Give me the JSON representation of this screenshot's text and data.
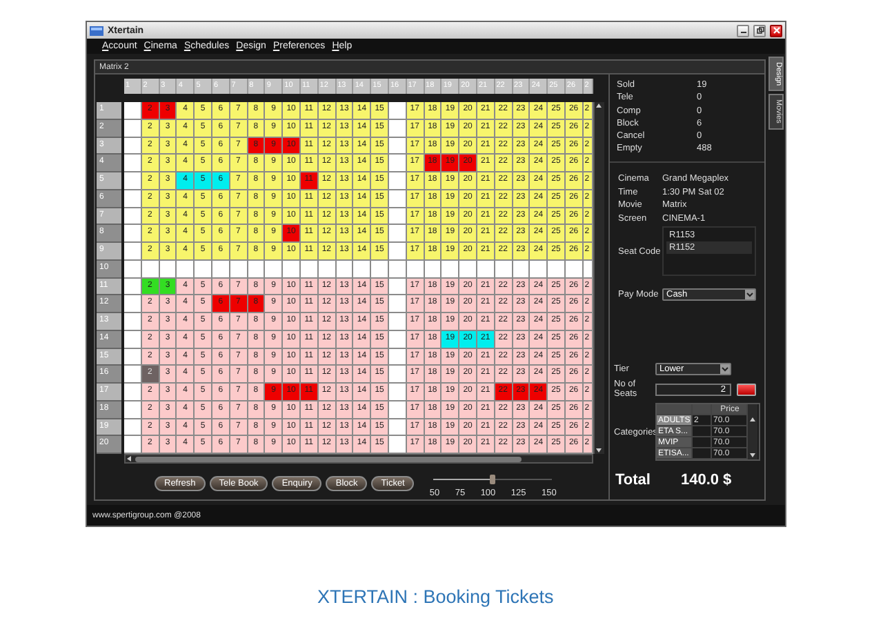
{
  "window": {
    "title": "Xtertain"
  },
  "menu": [
    "Account",
    "Cinema",
    "Schedules",
    "Design",
    "Preferences",
    "Help"
  ],
  "side_tabs": [
    {
      "label": "Design",
      "selected": true
    },
    {
      "label": "Movies",
      "selected": false
    }
  ],
  "frame_title": "Matrix 2",
  "columns": [
    "1",
    "2",
    "3",
    "4",
    "5",
    "6",
    "7",
    "8",
    "9",
    "10",
    "11",
    "12",
    "13",
    "14",
    "15",
    "16",
    "17",
    "18",
    "19",
    "20",
    "21",
    "22",
    "23",
    "24",
    "25",
    "26",
    "2"
  ],
  "rows": [
    {
      "label": "1",
      "kind": "seats",
      "color": "#f7f56c",
      "left_seats": [
        {
          "text": "2",
          "kind": "sold"
        },
        {
          "text": "3",
          "kind": "sold"
        },
        {
          "text": "4",
          "kind": "free"
        },
        {
          "text": "5",
          "kind": "free"
        },
        {
          "text": "6",
          "kind": "free"
        },
        {
          "text": "7",
          "kind": "free"
        },
        {
          "text": "8",
          "kind": "free"
        },
        {
          "text": "9",
          "kind": "free"
        },
        {
          "text": "10",
          "kind": "free"
        },
        {
          "text": "11",
          "kind": "free"
        },
        {
          "text": "12",
          "kind": "free"
        },
        {
          "text": "13",
          "kind": "free"
        },
        {
          "text": "14",
          "kind": "free"
        },
        {
          "text": "15",
          "kind": "free"
        }
      ],
      "right_seats": [
        {
          "text": "17",
          "kind": "free"
        },
        {
          "text": "18",
          "kind": "free"
        },
        {
          "text": "19",
          "kind": "free"
        },
        {
          "text": "20",
          "kind": "free"
        },
        {
          "text": "21",
          "kind": "free"
        },
        {
          "text": "22",
          "kind": "free"
        },
        {
          "text": "23",
          "kind": "free"
        },
        {
          "text": "24",
          "kind": "free"
        },
        {
          "text": "25",
          "kind": "free"
        },
        {
          "text": "26",
          "kind": "free"
        },
        {
          "text": "2",
          "kind": "free"
        }
      ]
    },
    {
      "label": "2",
      "kind": "seats",
      "color": "#f7f56c",
      "left_seats": [
        {
          "text": "2",
          "kind": "free"
        },
        {
          "text": "3",
          "kind": "free"
        },
        {
          "text": "4",
          "kind": "free"
        },
        {
          "text": "5",
          "kind": "free"
        },
        {
          "text": "6",
          "kind": "free"
        },
        {
          "text": "7",
          "kind": "free"
        },
        {
          "text": "8",
          "kind": "free"
        },
        {
          "text": "9",
          "kind": "free"
        },
        {
          "text": "10",
          "kind": "free"
        },
        {
          "text": "11",
          "kind": "free"
        },
        {
          "text": "12",
          "kind": "free"
        },
        {
          "text": "13",
          "kind": "free"
        },
        {
          "text": "14",
          "kind": "free"
        },
        {
          "text": "15",
          "kind": "free"
        }
      ],
      "right_seats": [
        {
          "text": "17",
          "kind": "free"
        },
        {
          "text": "18",
          "kind": "free"
        },
        {
          "text": "19",
          "kind": "free"
        },
        {
          "text": "20",
          "kind": "free"
        },
        {
          "text": "21",
          "kind": "free"
        },
        {
          "text": "22",
          "kind": "free"
        },
        {
          "text": "23",
          "kind": "free"
        },
        {
          "text": "24",
          "kind": "free"
        },
        {
          "text": "25",
          "kind": "free"
        },
        {
          "text": "26",
          "kind": "free"
        },
        {
          "text": "2",
          "kind": "free"
        }
      ]
    },
    {
      "label": "3",
      "kind": "seats",
      "color": "#f7f56c",
      "left_seats": [
        {
          "text": "2",
          "kind": "free"
        },
        {
          "text": "3",
          "kind": "free"
        },
        {
          "text": "4",
          "kind": "free"
        },
        {
          "text": "5",
          "kind": "free"
        },
        {
          "text": "6",
          "kind": "free"
        },
        {
          "text": "7",
          "kind": "free"
        },
        {
          "text": "8",
          "kind": "sold"
        },
        {
          "text": "9",
          "kind": "sold"
        },
        {
          "text": "10",
          "kind": "sold"
        },
        {
          "text": "11",
          "kind": "free"
        },
        {
          "text": "12",
          "kind": "free"
        },
        {
          "text": "13",
          "kind": "free"
        },
        {
          "text": "14",
          "kind": "free"
        },
        {
          "text": "15",
          "kind": "free"
        }
      ],
      "right_seats": [
        {
          "text": "17",
          "kind": "free"
        },
        {
          "text": "18",
          "kind": "free"
        },
        {
          "text": "19",
          "kind": "free"
        },
        {
          "text": "20",
          "kind": "free"
        },
        {
          "text": "21",
          "kind": "free"
        },
        {
          "text": "22",
          "kind": "free"
        },
        {
          "text": "23",
          "kind": "free"
        },
        {
          "text": "24",
          "kind": "free"
        },
        {
          "text": "25",
          "kind": "free"
        },
        {
          "text": "26",
          "kind": "free"
        },
        {
          "text": "2",
          "kind": "free"
        }
      ]
    },
    {
      "label": "4",
      "kind": "seats",
      "color": "#f7f56c",
      "left_seats": [
        {
          "text": "2",
          "kind": "free"
        },
        {
          "text": "3",
          "kind": "free"
        },
        {
          "text": "4",
          "kind": "free"
        },
        {
          "text": "5",
          "kind": "free"
        },
        {
          "text": "6",
          "kind": "free"
        },
        {
          "text": "7",
          "kind": "free"
        },
        {
          "text": "8",
          "kind": "free"
        },
        {
          "text": "9",
          "kind": "free"
        },
        {
          "text": "10",
          "kind": "free"
        },
        {
          "text": "11",
          "kind": "free"
        },
        {
          "text": "12",
          "kind": "free"
        },
        {
          "text": "13",
          "kind": "free"
        },
        {
          "text": "14",
          "kind": "free"
        },
        {
          "text": "15",
          "kind": "free"
        }
      ],
      "right_seats": [
        {
          "text": "17",
          "kind": "free"
        },
        {
          "text": "18",
          "kind": "sold"
        },
        {
          "text": "19",
          "kind": "sold"
        },
        {
          "text": "20",
          "kind": "sold"
        },
        {
          "text": "21",
          "kind": "free"
        },
        {
          "text": "22",
          "kind": "free"
        },
        {
          "text": "23",
          "kind": "free"
        },
        {
          "text": "24",
          "kind": "free"
        },
        {
          "text": "25",
          "kind": "free"
        },
        {
          "text": "26",
          "kind": "free"
        },
        {
          "text": "2",
          "kind": "free"
        }
      ]
    },
    {
      "label": "5",
      "kind": "seats",
      "color": "#f7f56c",
      "left_seats": [
        {
          "text": "2",
          "kind": "free"
        },
        {
          "text": "3",
          "kind": "free"
        },
        {
          "text": "4",
          "kind": "picked"
        },
        {
          "text": "5",
          "kind": "picked"
        },
        {
          "text": "6",
          "kind": "picked"
        },
        {
          "text": "7",
          "kind": "free"
        },
        {
          "text": "8",
          "kind": "free"
        },
        {
          "text": "9",
          "kind": "free"
        },
        {
          "text": "10",
          "kind": "free"
        },
        {
          "text": "11",
          "kind": "sold"
        },
        {
          "text": "12",
          "kind": "free"
        },
        {
          "text": "13",
          "kind": "free"
        },
        {
          "text": "14",
          "kind": "free"
        },
        {
          "text": "15",
          "kind": "free"
        }
      ],
      "right_seats": [
        {
          "text": "17",
          "kind": "free"
        },
        {
          "text": "18",
          "kind": "free"
        },
        {
          "text": "19",
          "kind": "free"
        },
        {
          "text": "20",
          "kind": "free"
        },
        {
          "text": "21",
          "kind": "free"
        },
        {
          "text": "22",
          "kind": "free"
        },
        {
          "text": "23",
          "kind": "free"
        },
        {
          "text": "24",
          "kind": "free"
        },
        {
          "text": "25",
          "kind": "free"
        },
        {
          "text": "26",
          "kind": "free"
        },
        {
          "text": "2",
          "kind": "free"
        }
      ]
    },
    {
      "label": "6",
      "kind": "seats",
      "color": "#f7f56c",
      "left_seats": [
        {
          "text": "2",
          "kind": "free"
        },
        {
          "text": "3",
          "kind": "free"
        },
        {
          "text": "4",
          "kind": "free"
        },
        {
          "text": "5",
          "kind": "free"
        },
        {
          "text": "6",
          "kind": "free"
        },
        {
          "text": "7",
          "kind": "free"
        },
        {
          "text": "8",
          "kind": "free"
        },
        {
          "text": "9",
          "kind": "free"
        },
        {
          "text": "10",
          "kind": "free"
        },
        {
          "text": "11",
          "kind": "free"
        },
        {
          "text": "12",
          "kind": "free"
        },
        {
          "text": "13",
          "kind": "free"
        },
        {
          "text": "14",
          "kind": "free"
        },
        {
          "text": "15",
          "kind": "free"
        }
      ],
      "right_seats": [
        {
          "text": "17",
          "kind": "free"
        },
        {
          "text": "18",
          "kind": "free"
        },
        {
          "text": "19",
          "kind": "free"
        },
        {
          "text": "20",
          "kind": "free"
        },
        {
          "text": "21",
          "kind": "free"
        },
        {
          "text": "22",
          "kind": "free"
        },
        {
          "text": "23",
          "kind": "free"
        },
        {
          "text": "24",
          "kind": "free"
        },
        {
          "text": "25",
          "kind": "free"
        },
        {
          "text": "26",
          "kind": "free"
        },
        {
          "text": "2",
          "kind": "free"
        }
      ]
    },
    {
      "label": "7",
      "kind": "seats",
      "color": "#f7f56c",
      "left_seats": [
        {
          "text": "2",
          "kind": "free"
        },
        {
          "text": "3",
          "kind": "free"
        },
        {
          "text": "4",
          "kind": "free"
        },
        {
          "text": "5",
          "kind": "free"
        },
        {
          "text": "6",
          "kind": "free"
        },
        {
          "text": "7",
          "kind": "free"
        },
        {
          "text": "8",
          "kind": "free"
        },
        {
          "text": "9",
          "kind": "free"
        },
        {
          "text": "10",
          "kind": "free"
        },
        {
          "text": "11",
          "kind": "free"
        },
        {
          "text": "12",
          "kind": "free"
        },
        {
          "text": "13",
          "kind": "free"
        },
        {
          "text": "14",
          "kind": "free"
        },
        {
          "text": "15",
          "kind": "free"
        }
      ],
      "right_seats": [
        {
          "text": "17",
          "kind": "free"
        },
        {
          "text": "18",
          "kind": "free"
        },
        {
          "text": "19",
          "kind": "free"
        },
        {
          "text": "20",
          "kind": "free"
        },
        {
          "text": "21",
          "kind": "free"
        },
        {
          "text": "22",
          "kind": "free"
        },
        {
          "text": "23",
          "kind": "free"
        },
        {
          "text": "24",
          "kind": "free"
        },
        {
          "text": "25",
          "kind": "free"
        },
        {
          "text": "26",
          "kind": "free"
        },
        {
          "text": "2",
          "kind": "free"
        }
      ]
    },
    {
      "label": "8",
      "kind": "seats",
      "color": "#f7f56c",
      "left_seats": [
        {
          "text": "2",
          "kind": "free"
        },
        {
          "text": "3",
          "kind": "free"
        },
        {
          "text": "4",
          "kind": "free"
        },
        {
          "text": "5",
          "kind": "free"
        },
        {
          "text": "6",
          "kind": "free"
        },
        {
          "text": "7",
          "kind": "free"
        },
        {
          "text": "8",
          "kind": "free"
        },
        {
          "text": "9",
          "kind": "free"
        },
        {
          "text": "10",
          "kind": "sold"
        },
        {
          "text": "11",
          "kind": "free"
        },
        {
          "text": "12",
          "kind": "free"
        },
        {
          "text": "13",
          "kind": "free"
        },
        {
          "text": "14",
          "kind": "free"
        },
        {
          "text": "15",
          "kind": "free"
        }
      ],
      "right_seats": [
        {
          "text": "17",
          "kind": "free"
        },
        {
          "text": "18",
          "kind": "free"
        },
        {
          "text": "19",
          "kind": "free"
        },
        {
          "text": "20",
          "kind": "free"
        },
        {
          "text": "21",
          "kind": "free"
        },
        {
          "text": "22",
          "kind": "free"
        },
        {
          "text": "23",
          "kind": "free"
        },
        {
          "text": "24",
          "kind": "free"
        },
        {
          "text": "25",
          "kind": "free"
        },
        {
          "text": "26",
          "kind": "free"
        },
        {
          "text": "2",
          "kind": "free"
        }
      ]
    },
    {
      "label": "9",
      "kind": "seats",
      "color": "#f7f56c",
      "left_seats": [
        {
          "text": "2",
          "kind": "free"
        },
        {
          "text": "3",
          "kind": "free"
        },
        {
          "text": "4",
          "kind": "free"
        },
        {
          "text": "5",
          "kind": "free"
        },
        {
          "text": "6",
          "kind": "free"
        },
        {
          "text": "7",
          "kind": "free"
        },
        {
          "text": "8",
          "kind": "free"
        },
        {
          "text": "9",
          "kind": "free"
        },
        {
          "text": "10",
          "kind": "free"
        },
        {
          "text": "11",
          "kind": "free"
        },
        {
          "text": "12",
          "kind": "free"
        },
        {
          "text": "13",
          "kind": "free"
        },
        {
          "text": "14",
          "kind": "free"
        },
        {
          "text": "15",
          "kind": "free"
        }
      ],
      "right_seats": [
        {
          "text": "17",
          "kind": "free"
        },
        {
          "text": "18",
          "kind": "free"
        },
        {
          "text": "19",
          "kind": "free"
        },
        {
          "text": "20",
          "kind": "free"
        },
        {
          "text": "21",
          "kind": "free"
        },
        {
          "text": "22",
          "kind": "free"
        },
        {
          "text": "23",
          "kind": "free"
        },
        {
          "text": "24",
          "kind": "free"
        },
        {
          "text": "25",
          "kind": "free"
        },
        {
          "text": "26",
          "kind": "free"
        },
        {
          "text": "2",
          "kind": "free"
        }
      ]
    },
    {
      "label": "10",
      "kind": "empty"
    },
    {
      "label": "11",
      "kind": "seats",
      "color": "#fccaca",
      "left_seats": [
        {
          "text": "2",
          "kind": "held"
        },
        {
          "text": "3",
          "kind": "held"
        },
        {
          "text": "4",
          "kind": "free"
        },
        {
          "text": "5",
          "kind": "free"
        },
        {
          "text": "6",
          "kind": "free"
        },
        {
          "text": "7",
          "kind": "free"
        },
        {
          "text": "8",
          "kind": "free"
        },
        {
          "text": "9",
          "kind": "free"
        },
        {
          "text": "10",
          "kind": "free"
        },
        {
          "text": "11",
          "kind": "free"
        },
        {
          "text": "12",
          "kind": "free"
        },
        {
          "text": "13",
          "kind": "free"
        },
        {
          "text": "14",
          "kind": "free"
        },
        {
          "text": "15",
          "kind": "free"
        }
      ],
      "right_seats": [
        {
          "text": "17",
          "kind": "free"
        },
        {
          "text": "18",
          "kind": "free"
        },
        {
          "text": "19",
          "kind": "free"
        },
        {
          "text": "20",
          "kind": "free"
        },
        {
          "text": "21",
          "kind": "free"
        },
        {
          "text": "22",
          "kind": "free"
        },
        {
          "text": "23",
          "kind": "free"
        },
        {
          "text": "24",
          "kind": "free"
        },
        {
          "text": "25",
          "kind": "free"
        },
        {
          "text": "26",
          "kind": "free"
        },
        {
          "text": "2",
          "kind": "free"
        }
      ]
    },
    {
      "label": "12",
      "kind": "seats",
      "color": "#fccaca",
      "left_seats": [
        {
          "text": "2",
          "kind": "free"
        },
        {
          "text": "3",
          "kind": "free"
        },
        {
          "text": "4",
          "kind": "free"
        },
        {
          "text": "5",
          "kind": "free"
        },
        {
          "text": "6",
          "kind": "sold"
        },
        {
          "text": "7",
          "kind": "sold"
        },
        {
          "text": "8",
          "kind": "sold"
        },
        {
          "text": "9",
          "kind": "free"
        },
        {
          "text": "10",
          "kind": "free"
        },
        {
          "text": "11",
          "kind": "free"
        },
        {
          "text": "12",
          "kind": "free"
        },
        {
          "text": "13",
          "kind": "free"
        },
        {
          "text": "14",
          "kind": "free"
        },
        {
          "text": "15",
          "kind": "free"
        }
      ],
      "right_seats": [
        {
          "text": "17",
          "kind": "free"
        },
        {
          "text": "18",
          "kind": "free"
        },
        {
          "text": "19",
          "kind": "free"
        },
        {
          "text": "20",
          "kind": "free"
        },
        {
          "text": "21",
          "kind": "free"
        },
        {
          "text": "22",
          "kind": "free"
        },
        {
          "text": "23",
          "kind": "free"
        },
        {
          "text": "24",
          "kind": "free"
        },
        {
          "text": "25",
          "kind": "free"
        },
        {
          "text": "26",
          "kind": "free"
        },
        {
          "text": "2",
          "kind": "free"
        }
      ]
    },
    {
      "label": "13",
      "kind": "seats",
      "color": "#fccaca",
      "left_seats": [
        {
          "text": "2",
          "kind": "free"
        },
        {
          "text": "3",
          "kind": "free"
        },
        {
          "text": "4",
          "kind": "free"
        },
        {
          "text": "5",
          "kind": "free"
        },
        {
          "text": "6",
          "kind": "free"
        },
        {
          "text": "7",
          "kind": "free"
        },
        {
          "text": "8",
          "kind": "free"
        },
        {
          "text": "9",
          "kind": "free"
        },
        {
          "text": "10",
          "kind": "free"
        },
        {
          "text": "11",
          "kind": "free"
        },
        {
          "text": "12",
          "kind": "free"
        },
        {
          "text": "13",
          "kind": "free"
        },
        {
          "text": "14",
          "kind": "free"
        },
        {
          "text": "15",
          "kind": "free"
        }
      ],
      "right_seats": [
        {
          "text": "17",
          "kind": "free"
        },
        {
          "text": "18",
          "kind": "free"
        },
        {
          "text": "19",
          "kind": "free"
        },
        {
          "text": "20",
          "kind": "free"
        },
        {
          "text": "21",
          "kind": "free"
        },
        {
          "text": "22",
          "kind": "free"
        },
        {
          "text": "23",
          "kind": "free"
        },
        {
          "text": "24",
          "kind": "free"
        },
        {
          "text": "25",
          "kind": "free"
        },
        {
          "text": "26",
          "kind": "free"
        },
        {
          "text": "2",
          "kind": "free"
        }
      ]
    },
    {
      "label": "14",
      "kind": "seats",
      "color": "#fccaca",
      "left_seats": [
        {
          "text": "2",
          "kind": "free"
        },
        {
          "text": "3",
          "kind": "free"
        },
        {
          "text": "4",
          "kind": "free"
        },
        {
          "text": "5",
          "kind": "free"
        },
        {
          "text": "6",
          "kind": "free"
        },
        {
          "text": "7",
          "kind": "free"
        },
        {
          "text": "8",
          "kind": "free"
        },
        {
          "text": "9",
          "kind": "free"
        },
        {
          "text": "10",
          "kind": "free"
        },
        {
          "text": "11",
          "kind": "free"
        },
        {
          "text": "12",
          "kind": "free"
        },
        {
          "text": "13",
          "kind": "free"
        },
        {
          "text": "14",
          "kind": "free"
        },
        {
          "text": "15",
          "kind": "free"
        }
      ],
      "right_seats": [
        {
          "text": "17",
          "kind": "free"
        },
        {
          "text": "18",
          "kind": "free"
        },
        {
          "text": "19",
          "kind": "picked"
        },
        {
          "text": "20",
          "kind": "picked"
        },
        {
          "text": "21",
          "kind": "picked"
        },
        {
          "text": "22",
          "kind": "free"
        },
        {
          "text": "23",
          "kind": "free"
        },
        {
          "text": "24",
          "kind": "free"
        },
        {
          "text": "25",
          "kind": "free"
        },
        {
          "text": "26",
          "kind": "free"
        },
        {
          "text": "2",
          "kind": "free"
        }
      ]
    },
    {
      "label": "15",
      "kind": "seats",
      "color": "#fccaca",
      "left_seats": [
        {
          "text": "2",
          "kind": "free"
        },
        {
          "text": "3",
          "kind": "free"
        },
        {
          "text": "4",
          "kind": "free"
        },
        {
          "text": "5",
          "kind": "free"
        },
        {
          "text": "6",
          "kind": "free"
        },
        {
          "text": "7",
          "kind": "free"
        },
        {
          "text": "8",
          "kind": "free"
        },
        {
          "text": "9",
          "kind": "free"
        },
        {
          "text": "10",
          "kind": "free"
        },
        {
          "text": "11",
          "kind": "free"
        },
        {
          "text": "12",
          "kind": "free"
        },
        {
          "text": "13",
          "kind": "free"
        },
        {
          "text": "14",
          "kind": "free"
        },
        {
          "text": "15",
          "kind": "free"
        }
      ],
      "right_seats": [
        {
          "text": "17",
          "kind": "free"
        },
        {
          "text": "18",
          "kind": "free"
        },
        {
          "text": "19",
          "kind": "free"
        },
        {
          "text": "20",
          "kind": "free"
        },
        {
          "text": "21",
          "kind": "free"
        },
        {
          "text": "22",
          "kind": "free"
        },
        {
          "text": "23",
          "kind": "free"
        },
        {
          "text": "24",
          "kind": "free"
        },
        {
          "text": "25",
          "kind": "free"
        },
        {
          "text": "26",
          "kind": "free"
        },
        {
          "text": "2",
          "kind": "free"
        }
      ]
    },
    {
      "label": "16",
      "kind": "seats",
      "color": "#fccaca",
      "left_seats": [
        {
          "text": "2",
          "kind": "blocked"
        },
        {
          "text": "3",
          "kind": "free"
        },
        {
          "text": "4",
          "kind": "free"
        },
        {
          "text": "5",
          "kind": "free"
        },
        {
          "text": "6",
          "kind": "free"
        },
        {
          "text": "7",
          "kind": "free"
        },
        {
          "text": "8",
          "kind": "free"
        },
        {
          "text": "9",
          "kind": "free"
        },
        {
          "text": "10",
          "kind": "free"
        },
        {
          "text": "11",
          "kind": "free"
        },
        {
          "text": "12",
          "kind": "free"
        },
        {
          "text": "13",
          "kind": "free"
        },
        {
          "text": "14",
          "kind": "free"
        },
        {
          "text": "15",
          "kind": "free"
        }
      ],
      "right_seats": [
        {
          "text": "17",
          "kind": "free"
        },
        {
          "text": "18",
          "kind": "free"
        },
        {
          "text": "19",
          "kind": "free"
        },
        {
          "text": "20",
          "kind": "free"
        },
        {
          "text": "21",
          "kind": "free"
        },
        {
          "text": "22",
          "kind": "free"
        },
        {
          "text": "23",
          "kind": "free"
        },
        {
          "text": "24",
          "kind": "free"
        },
        {
          "text": "25",
          "kind": "free"
        },
        {
          "text": "26",
          "kind": "free"
        },
        {
          "text": "2",
          "kind": "free"
        }
      ]
    },
    {
      "label": "17",
      "kind": "seats",
      "color": "#fccaca",
      "left_seats": [
        {
          "text": "2",
          "kind": "free"
        },
        {
          "text": "3",
          "kind": "free"
        },
        {
          "text": "4",
          "kind": "free"
        },
        {
          "text": "5",
          "kind": "free"
        },
        {
          "text": "6",
          "kind": "free"
        },
        {
          "text": "7",
          "kind": "free"
        },
        {
          "text": "8",
          "kind": "free"
        },
        {
          "text": "9",
          "kind": "sold"
        },
        {
          "text": "10",
          "kind": "sold"
        },
        {
          "text": "11",
          "kind": "sold"
        },
        {
          "text": "12",
          "kind": "free"
        },
        {
          "text": "13",
          "kind": "free"
        },
        {
          "text": "14",
          "kind": "free"
        },
        {
          "text": "15",
          "kind": "free"
        }
      ],
      "right_seats": [
        {
          "text": "17",
          "kind": "free"
        },
        {
          "text": "18",
          "kind": "free"
        },
        {
          "text": "19",
          "kind": "free"
        },
        {
          "text": "20",
          "kind": "free"
        },
        {
          "text": "21",
          "kind": "free"
        },
        {
          "text": "22",
          "kind": "sold"
        },
        {
          "text": "23",
          "kind": "sold"
        },
        {
          "text": "24",
          "kind": "sold"
        },
        {
          "text": "25",
          "kind": "free"
        },
        {
          "text": "26",
          "kind": "free"
        },
        {
          "text": "2",
          "kind": "free"
        }
      ]
    },
    {
      "label": "18",
      "kind": "seats",
      "color": "#fccaca",
      "left_seats": [
        {
          "text": "2",
          "kind": "free"
        },
        {
          "text": "3",
          "kind": "free"
        },
        {
          "text": "4",
          "kind": "free"
        },
        {
          "text": "5",
          "kind": "free"
        },
        {
          "text": "6",
          "kind": "free"
        },
        {
          "text": "7",
          "kind": "free"
        },
        {
          "text": "8",
          "kind": "free"
        },
        {
          "text": "9",
          "kind": "free"
        },
        {
          "text": "10",
          "kind": "free"
        },
        {
          "text": "11",
          "kind": "free"
        },
        {
          "text": "12",
          "kind": "free"
        },
        {
          "text": "13",
          "kind": "free"
        },
        {
          "text": "14",
          "kind": "free"
        },
        {
          "text": "15",
          "kind": "free"
        }
      ],
      "right_seats": [
        {
          "text": "17",
          "kind": "free"
        },
        {
          "text": "18",
          "kind": "free"
        },
        {
          "text": "19",
          "kind": "free"
        },
        {
          "text": "20",
          "kind": "free"
        },
        {
          "text": "21",
          "kind": "free"
        },
        {
          "text": "22",
          "kind": "free"
        },
        {
          "text": "23",
          "kind": "free"
        },
        {
          "text": "24",
          "kind": "free"
        },
        {
          "text": "25",
          "kind": "free"
        },
        {
          "text": "26",
          "kind": "free"
        },
        {
          "text": "2",
          "kind": "free"
        }
      ]
    },
    {
      "label": "19",
      "kind": "seats",
      "color": "#fccaca",
      "left_seats": [
        {
          "text": "2",
          "kind": "free"
        },
        {
          "text": "3",
          "kind": "free"
        },
        {
          "text": "4",
          "kind": "free"
        },
        {
          "text": "5",
          "kind": "free"
        },
        {
          "text": "6",
          "kind": "free"
        },
        {
          "text": "7",
          "kind": "free"
        },
        {
          "text": "8",
          "kind": "free"
        },
        {
          "text": "9",
          "kind": "free"
        },
        {
          "text": "10",
          "kind": "free"
        },
        {
          "text": "11",
          "kind": "free"
        },
        {
          "text": "12",
          "kind": "free"
        },
        {
          "text": "13",
          "kind": "free"
        },
        {
          "text": "14",
          "kind": "free"
        },
        {
          "text": "15",
          "kind": "free"
        }
      ],
      "right_seats": [
        {
          "text": "17",
          "kind": "free"
        },
        {
          "text": "18",
          "kind": "free"
        },
        {
          "text": "19",
          "kind": "free"
        },
        {
          "text": "20",
          "kind": "free"
        },
        {
          "text": "21",
          "kind": "free"
        },
        {
          "text": "22",
          "kind": "free"
        },
        {
          "text": "23",
          "kind": "free"
        },
        {
          "text": "24",
          "kind": "free"
        },
        {
          "text": "25",
          "kind": "free"
        },
        {
          "text": "26",
          "kind": "free"
        },
        {
          "text": "2",
          "kind": "free"
        }
      ]
    },
    {
      "label": "20",
      "kind": "seats",
      "color": "#fccaca",
      "left_seats": [
        {
          "text": "2",
          "kind": "free"
        },
        {
          "text": "3",
          "kind": "free"
        },
        {
          "text": "4",
          "kind": "free"
        },
        {
          "text": "5",
          "kind": "free"
        },
        {
          "text": "6",
          "kind": "free"
        },
        {
          "text": "7",
          "kind": "free"
        },
        {
          "text": "8",
          "kind": "free"
        },
        {
          "text": "9",
          "kind": "free"
        },
        {
          "text": "10",
          "kind": "free"
        },
        {
          "text": "11",
          "kind": "free"
        },
        {
          "text": "12",
          "kind": "free"
        },
        {
          "text": "13",
          "kind": "free"
        },
        {
          "text": "14",
          "kind": "free"
        },
        {
          "text": "15",
          "kind": "free"
        }
      ],
      "right_seats": [
        {
          "text": "17",
          "kind": "free"
        },
        {
          "text": "18",
          "kind": "free"
        },
        {
          "text": "19",
          "kind": "free"
        },
        {
          "text": "20",
          "kind": "free"
        },
        {
          "text": "21",
          "kind": "free"
        },
        {
          "text": "22",
          "kind": "free"
        },
        {
          "text": "23",
          "kind": "free"
        },
        {
          "text": "24",
          "kind": "free"
        },
        {
          "text": "25",
          "kind": "free"
        },
        {
          "text": "26",
          "kind": "free"
        },
        {
          "text": "2",
          "kind": "free"
        }
      ]
    }
  ],
  "actions": [
    "Refresh",
    "Tele Book",
    "Enquiry",
    "Block",
    "Ticket"
  ],
  "zoom_slider": {
    "level": 0.5,
    "ticks": [
      "50",
      "75",
      "100",
      "125",
      "150"
    ]
  },
  "stats": [
    {
      "label": "Sold",
      "value": "19"
    },
    {
      "label": "Tele",
      "value": "0"
    },
    {
      "label": "Comp",
      "value": "0"
    },
    {
      "label": "Block",
      "value": "6"
    },
    {
      "label": "Cancel",
      "value": "0"
    },
    {
      "label": "Empty",
      "value": "488"
    }
  ],
  "show_info": [
    {
      "label": "Cinema",
      "value": "Grand Megaplex"
    },
    {
      "label": "Time",
      "value": "1:30 PM  Sat 02"
    },
    {
      "label": "Movie",
      "value": "Matrix"
    },
    {
      "label": "Screen",
      "value": "CINEMA-1"
    }
  ],
  "seat_code": {
    "label": "Seat Code",
    "items": [
      {
        "text": "R1153",
        "selected": false
      },
      {
        "text": "R1152",
        "selected": true
      }
    ]
  },
  "pay_mode": {
    "label": "Pay Mode",
    "value": "Cash"
  },
  "tier": {
    "label": "Tier",
    "value": "Lower"
  },
  "seats_count": {
    "label": "No of Seats",
    "value": "2"
  },
  "categories": {
    "label": "Categories",
    "header": "Price",
    "rows": [
      {
        "name": "ADULTS",
        "qty": "2",
        "price": "70.0",
        "selected": true
      },
      {
        "name": "ETA S...",
        "price": "70.0",
        "selected": false
      },
      {
        "name": "MVIP",
        "price": "70.0",
        "selected": false
      },
      {
        "name": "ETISA...",
        "price": "70.0",
        "selected": false
      }
    ]
  },
  "total": {
    "label": "Total",
    "value": "140.0 $"
  },
  "footer": "www.spertigroup.com @2008",
  "caption": "XTERTAIN : Booking Tickets"
}
